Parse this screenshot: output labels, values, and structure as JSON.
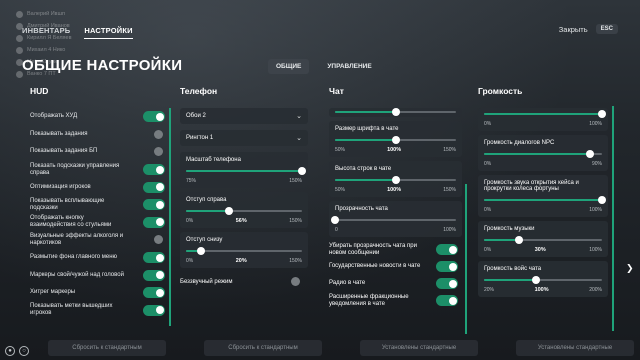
{
  "nav": {
    "tabs": [
      "ИНВЕНТАРЬ",
      "НАСТРОЙКИ"
    ],
    "close_label": "Закрыть",
    "esc_label": "ESC"
  },
  "ghost_players": [
    "Валерий Ившп",
    "Дмитрий Иванов",
    "Кирилл Я Беляев",
    "Михаил 4 Нико",
    "Metro61 уже",
    "Ванко 7 ПТ"
  ],
  "title": "ОБЩИЕ НАСТРОЙКИ",
  "subtabs": [
    "ОБЩИЕ",
    "УПРАВЛЕНИЕ"
  ],
  "hud": {
    "title": "HUD",
    "items": [
      {
        "label": "Отображать ХУД",
        "on": true
      },
      {
        "label": "Показывать задания",
        "on": false
      },
      {
        "label": "Показывать задания БП",
        "on": false
      },
      {
        "label": "Показать подсказки управления справа",
        "on": true
      },
      {
        "label": "Оптимизация игроков",
        "on": true
      },
      {
        "label": "Показывать всплывающие подсказки",
        "on": true
      },
      {
        "label": "Отображать кнопку взаимодействия со стульями",
        "on": true
      },
      {
        "label": "Визуальные эффекты алкоголя и наркотиков",
        "on": false
      },
      {
        "label": "Размытие фона главного меню",
        "on": true
      },
      {
        "label": "Маркеры свой/чужой над головой",
        "on": true
      },
      {
        "label": "Хитрег маркеры",
        "on": true
      },
      {
        "label": "Показывать метки вышедших игроков",
        "on": true
      }
    ]
  },
  "phone": {
    "title": "Телефон",
    "wallpaper": "Обои 2",
    "ringtone": "Рингтон 1",
    "scale": {
      "label": "Масштаб телефона",
      "min": "75%",
      "max": "150%",
      "value": 150,
      "low": 75,
      "high": 150,
      "cur": ""
    },
    "right": {
      "label": "Отступ справа",
      "min": "0%",
      "cur": "56%",
      "max": "150%",
      "value": 56,
      "low": 0,
      "high": 150
    },
    "bottom": {
      "label": "Отступ снизу",
      "min": "0%",
      "cur": "20%",
      "max": "150%",
      "value": 20,
      "low": 0,
      "high": 150
    },
    "silent_label": "Беззвучный режим"
  },
  "chat": {
    "title": "Чат",
    "font": {
      "label": "Размер шрифта в чате",
      "min": "50%",
      "cur": "100%",
      "max": "150%",
      "value": 100,
      "low": 50,
      "high": 150
    },
    "height": {
      "label": "Высота строк в чате",
      "min": "50%",
      "cur": "100%",
      "max": "150%",
      "value": 100,
      "low": 50,
      "high": 150
    },
    "opacity": {
      "label": "Прозрачность чата",
      "min": "0",
      "cur": "",
      "max": "100%",
      "value": 0,
      "low": 0,
      "high": 100
    },
    "toggles": [
      {
        "label": "Убирать прозрачность чата при новом сообщении",
        "on": true
      },
      {
        "label": "Государственные новости в чате",
        "on": true
      },
      {
        "label": "Радио в чате",
        "on": true
      },
      {
        "label": "Расширенные фракционные уведомления в чате",
        "on": true
      }
    ]
  },
  "volume": {
    "title": "Громкость",
    "top": {
      "min": "0%",
      "cur": "",
      "max": "100%",
      "value": 100,
      "low": 0,
      "high": 100
    },
    "npc": {
      "label": "Громкость диалогов NPC",
      "min": "0%",
      "cur": "",
      "max": "90%",
      "value": 90,
      "low": 0,
      "high": 100
    },
    "case": {
      "label": "Громкость звука открытия кейса и прокрутки колеса фортуны",
      "min": "0%",
      "cur": "",
      "max": "100%",
      "value": 100,
      "low": 0,
      "high": 100
    },
    "music": {
      "label": "Громкость музыки",
      "min": "0%",
      "cur": "30%",
      "max": "100%",
      "value": 30,
      "low": 0,
      "high": 100
    },
    "voice": {
      "label": "Громкость войс чата",
      "min": "20%",
      "cur": "100%",
      "max": "200%",
      "value": 100,
      "low": 20,
      "high": 200
    }
  },
  "footer": [
    "Сбросить к стандартным",
    "Сбросить к стандартным",
    "Установлены стандартные",
    "Установлены стандартные"
  ]
}
